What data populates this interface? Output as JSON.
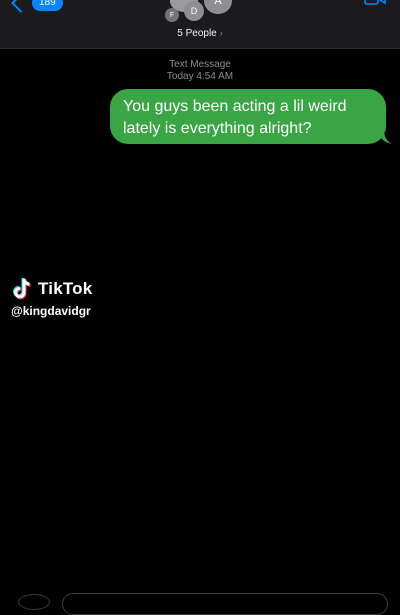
{
  "header": {
    "back_count": "189",
    "avatar_initials": [
      "F",
      "D",
      "A"
    ],
    "group_label": "5 People",
    "chevron": "›"
  },
  "conversation": {
    "service_label": "Text Message",
    "timestamp_day": "Today",
    "timestamp_time": "4:54 AM",
    "messages": [
      {
        "sender": "me",
        "text": "You guys been acting a lil weird lately is everything alright?",
        "bubble_color": "#3aa545"
      }
    ]
  },
  "watermark": {
    "brand": "TikTok",
    "handle": "@kingdavidgr",
    "icon": "tiktok-note-icon"
  },
  "colors": {
    "background": "#000000",
    "header_bg": "#1b1b1d",
    "accent": "#0a84ff",
    "sms_green": "#3aa545",
    "muted_text": "#8e8e93"
  }
}
